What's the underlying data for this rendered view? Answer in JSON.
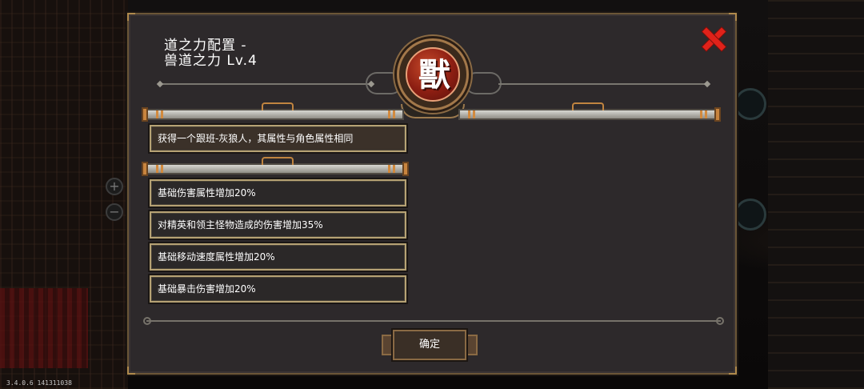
{
  "dialog": {
    "title": "道之力配置 -\n兽道之力 Lv.4",
    "emblem_char": "獸",
    "confirm_label": "确定"
  },
  "main_effect": "获得一个跟班-灰狼人，其属性与角色属性相同",
  "bonuses": [
    "基础伤害属性增加20%",
    "对精英和领主怪物造成的伤害增加35%",
    "基础移动速度属性增加20%",
    "基础暴击伤害增加20%"
  ],
  "version": "3.4.0.6 141311038",
  "colors": {
    "panel_bg": "#2d292b",
    "border_gold": "#b6a274",
    "close_red": "#e0221a",
    "emblem_red": "#8c1e12"
  },
  "icons": [
    "close-icon",
    "beast-emblem-icon",
    "plus-icon",
    "minus-icon"
  ]
}
